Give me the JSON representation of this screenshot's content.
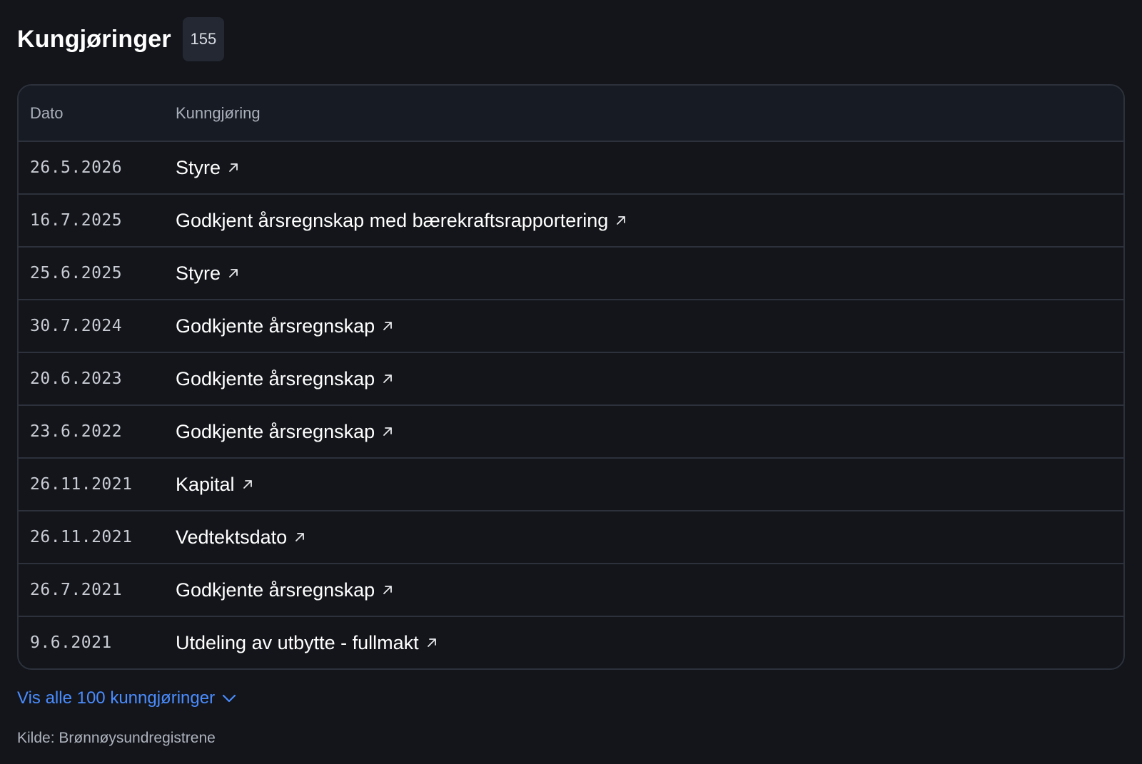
{
  "header": {
    "title": "Kungjøringer",
    "count": "155"
  },
  "table": {
    "columns": {
      "date": "Dato",
      "announcement": "Kunngjøring"
    },
    "rows": [
      {
        "date": "26.5.2026",
        "label": "Styre"
      },
      {
        "date": "16.7.2025",
        "label": "Godkjent årsregnskap med bærekraftsrapportering"
      },
      {
        "date": "25.6.2025",
        "label": "Styre"
      },
      {
        "date": "30.7.2024",
        "label": "Godkjente årsregnskap"
      },
      {
        "date": "20.6.2023",
        "label": "Godkjente årsregnskap"
      },
      {
        "date": "23.6.2022",
        "label": "Godkjente årsregnskap"
      },
      {
        "date": "26.11.2021",
        "label": "Kapital"
      },
      {
        "date": "26.11.2021",
        "label": "Vedtektsdato"
      },
      {
        "date": "26.7.2021",
        "label": "Godkjente årsregnskap"
      },
      {
        "date": "9.6.2021",
        "label": "Utdeling av utbytte - fullmakt"
      }
    ]
  },
  "footer": {
    "show_all_label": "Vis alle 100 kunngjøringer",
    "source": "Kilde: Brønnøysundregistrene"
  },
  "icons": {
    "row_link": "external-link-arrow-icon",
    "show_all": "chevron-down-icon"
  },
  "colors": {
    "background": "#13151a",
    "accent": "#4a8cff",
    "border": "#2c313b"
  }
}
